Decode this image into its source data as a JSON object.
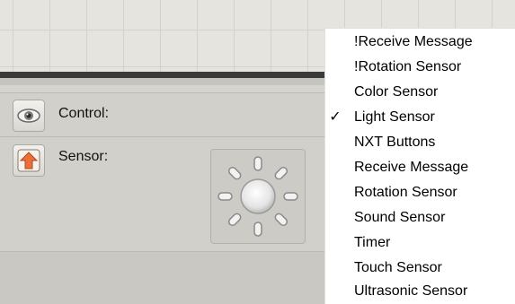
{
  "properties": {
    "control_label": "Control:",
    "sensor_label": "Sensor:",
    "control_icon": "eye-icon",
    "sensor_icon": "sensor-arrow-icon",
    "sensor_preview_icon": "light-sensor-icon"
  },
  "dropdown": {
    "selected": "Light Sensor",
    "items": [
      {
        "label": "!Receive Message",
        "checked": false
      },
      {
        "label": "!Rotation Sensor",
        "checked": false
      },
      {
        "label": "Color Sensor",
        "checked": false
      },
      {
        "label": "Light Sensor",
        "checked": true,
        "check_mark": "✓"
      },
      {
        "label": "NXT Buttons",
        "checked": false
      },
      {
        "label": "Receive Message",
        "checked": false
      },
      {
        "label": "Rotation Sensor",
        "checked": false
      },
      {
        "label": "Sound Sensor",
        "checked": false
      },
      {
        "label": "Timer",
        "checked": false
      },
      {
        "label": "Touch Sensor",
        "checked": false
      },
      {
        "label": "Ultrasonic Sensor",
        "checked": false
      }
    ]
  },
  "colors": {
    "menu_background": "#ffffff",
    "panel_background": "#d2d0ca",
    "dark_bar": "#3a3a3a"
  }
}
